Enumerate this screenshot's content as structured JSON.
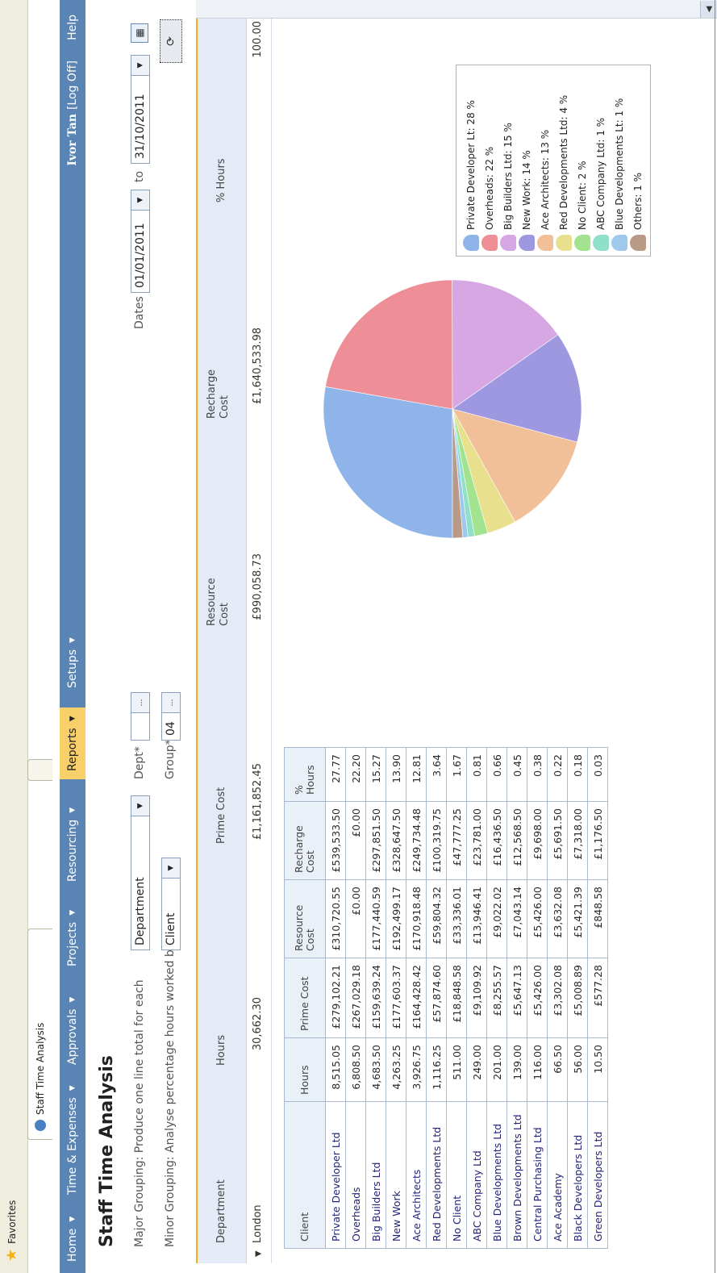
{
  "browser": {
    "favorites_label": "Favorites",
    "tab_title": "Staff Time Analysis"
  },
  "nav": {
    "items": [
      {
        "label": "Home"
      },
      {
        "label": "Time & Expenses"
      },
      {
        "label": "Approvals"
      },
      {
        "label": "Projects"
      },
      {
        "label": "Resourcing"
      },
      {
        "label": "Reports"
      },
      {
        "label": "Setups"
      }
    ],
    "active_item": "Reports",
    "user_name": "Ivor Tan",
    "logoff_label": "[Log Off]",
    "help_label": "Help"
  },
  "page": {
    "title": "Staff Time Analysis",
    "major_grouping_label": "Major Grouping: Produce one line total for each",
    "major_grouping_value": "Department",
    "minor_grouping_label": "Minor Grouping: Analyse percentage hours worked by",
    "minor_grouping_value": "Client",
    "dept_label": "Dept*",
    "dept_value": "",
    "group_label": "Group*",
    "group_value": "04",
    "dates_label": "Dates",
    "date_from": "01/01/2011",
    "to_label": "to",
    "date_to": "31/10/2011"
  },
  "summary": {
    "headers": {
      "department": "Department",
      "hours": "Hours",
      "prime_cost": "Prime Cost",
      "resource_cost_1": "Resource",
      "resource_cost_2": "Cost",
      "recharge_cost_1": "Recharge",
      "recharge_cost_2": "Cost",
      "pct_hours": "% Hours"
    },
    "row": {
      "department": "London",
      "hours": "30,662.30",
      "prime_cost": "£1,161,852.45",
      "resource_cost": "£990,058.73",
      "recharge_cost": "£1,640,533.98",
      "pct_hours": "100.00"
    }
  },
  "detail": {
    "headers": [
      "Client",
      "Hours",
      "Prime Cost",
      "Resource Cost",
      "Recharge Cost",
      "% Hours"
    ],
    "rows": [
      [
        "Private Developer Ltd",
        "8,515.05",
        "£279,102.21",
        "£310,720.55",
        "£539,533.50",
        "27.77"
      ],
      [
        "Overheads",
        "6,808.50",
        "£267,029.18",
        "£0.00",
        "£0.00",
        "22.20"
      ],
      [
        "Big Builders Ltd",
        "4,683.50",
        "£159,639.24",
        "£177,440.59",
        "£297,851.50",
        "15.27"
      ],
      [
        "New Work",
        "4,263.25",
        "£177,603.37",
        "£192,499.17",
        "£328,647.50",
        "13.90"
      ],
      [
        "Ace Architects",
        "3,926.75",
        "£164,428.42",
        "£170,918.48",
        "£249,734.48",
        "12.81"
      ],
      [
        "Red Developments Ltd",
        "1,116.25",
        "£57,874.60",
        "£59,804.32",
        "£100,319.75",
        "3.64"
      ],
      [
        "No Client",
        "511.00",
        "£18,848.58",
        "£33,336.01",
        "£47,777.25",
        "1.67"
      ],
      [
        "ABC Company Ltd",
        "249.00",
        "£9,109.92",
        "£13,946.41",
        "£23,781.00",
        "0.81"
      ],
      [
        "Blue Developments Ltd",
        "201.00",
        "£8,255.57",
        "£9,022.02",
        "£16,436.50",
        "0.66"
      ],
      [
        "Brown Developments Ltd",
        "139.00",
        "£5,647.13",
        "£7,043.14",
        "£12,568.50",
        "0.45"
      ],
      [
        "Central Purchasing Ltd",
        "116.00",
        "£5,426.00",
        "£5,426.00",
        "£9,698.00",
        "0.38"
      ],
      [
        "Ace Academy",
        "66.50",
        "£3,302.08",
        "£3,632.08",
        "£5,691.50",
        "0.22"
      ],
      [
        "Black Developers Ltd",
        "56.00",
        "£5,008.89",
        "£5,421.39",
        "£7,318.00",
        "0.18"
      ],
      [
        "Green Developers Ltd",
        "10.50",
        "£577.28",
        "£848.58",
        "£1,176.50",
        "0.03"
      ]
    ]
  },
  "chart_data": {
    "type": "pie",
    "slices": [
      {
        "label": "Private Developer Lt: 28 %",
        "value": 27.77,
        "color": "#8fb4ea"
      },
      {
        "label": "Overheads: 22 %",
        "value": 22.2,
        "color": "#ee8e97"
      },
      {
        "label": "Big Builders Ltd: 15 %",
        "value": 15.27,
        "color": "#d6a7e2"
      },
      {
        "label": "New Work: 14 %",
        "value": 13.9,
        "color": "#9e98e0"
      },
      {
        "label": "Ace Architects: 13 %",
        "value": 12.81,
        "color": "#f1bf98"
      },
      {
        "label": "Red Developments Ltd: 4 %",
        "value": 3.64,
        "color": "#e9e08e"
      },
      {
        "label": "No Client: 2 %",
        "value": 1.67,
        "color": "#a3e28f"
      },
      {
        "label": "ABC Company Ltd: 1 %",
        "value": 0.81,
        "color": "#8fe0c9"
      },
      {
        "label": "Blue Developments Lt: 1 %",
        "value": 0.66,
        "color": "#9fc9ec"
      },
      {
        "label": "Others: 1 %",
        "value": 1.28,
        "color": "#b99a86"
      }
    ]
  }
}
